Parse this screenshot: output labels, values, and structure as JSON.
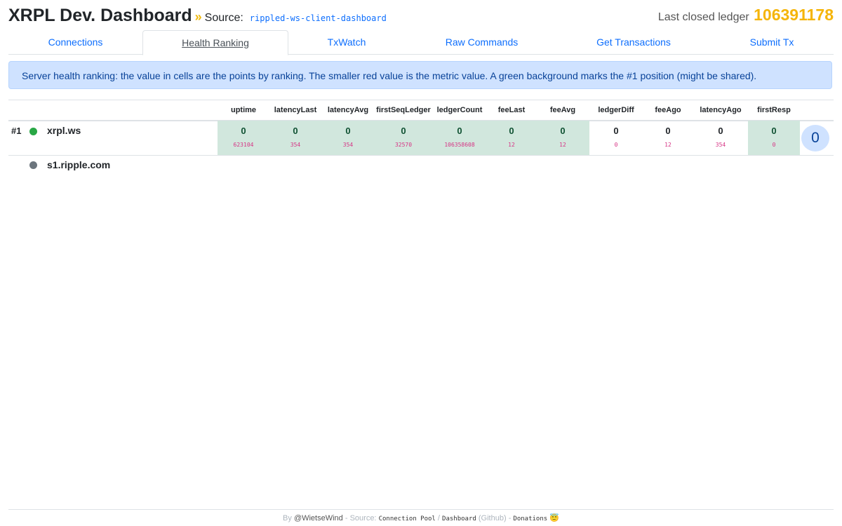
{
  "header": {
    "title": "XRPL Dev. Dashboard",
    "chevron": "»",
    "source_label": "Source:",
    "source_value": "rippled-ws-client-dashboard",
    "ledger_label": "Last closed ledger",
    "ledger_value": "106391178"
  },
  "tabs": [
    {
      "label": "Connections"
    },
    {
      "label": "Health Ranking"
    },
    {
      "label": "TxWatch"
    },
    {
      "label": "Raw Commands"
    },
    {
      "label": "Get Transactions"
    },
    {
      "label": "Submit Tx"
    }
  ],
  "info_alert": "Server health ranking: the value in cells are the points by ranking. The smaller red value is the metric value. A green background marks the #1 position (might be shared).",
  "columns": [
    "uptime",
    "latencyLast",
    "latencyAvg",
    "firstSeqLedger",
    "ledgerCount",
    "feeLast",
    "feeAvg",
    "ledgerDiff",
    "feeAgo",
    "latencyAgo",
    "firstResp"
  ],
  "servers": [
    {
      "rank": "#1",
      "name": "xrpl.ws",
      "status_color": "#28a745",
      "cells": [
        {
          "points": "0",
          "metric": "623104",
          "first": true
        },
        {
          "points": "0",
          "metric": "354",
          "first": true
        },
        {
          "points": "0",
          "metric": "354",
          "first": true
        },
        {
          "points": "0",
          "metric": "32570",
          "first": true
        },
        {
          "points": "0",
          "metric": "106358608",
          "first": true
        },
        {
          "points": "0",
          "metric": "12",
          "first": true
        },
        {
          "points": "0",
          "metric": "12",
          "first": true
        },
        {
          "points": "0",
          "metric": "0",
          "first": false
        },
        {
          "points": "0",
          "metric": "12",
          "first": false
        },
        {
          "points": "0",
          "metric": "354",
          "first": false
        },
        {
          "points": "0",
          "metric": "0",
          "first": true
        }
      ],
      "total": "0"
    },
    {
      "rank": "",
      "name": "s1.ripple.com",
      "status_color": "#6c757d"
    }
  ],
  "footer": {
    "by": "By",
    "author": "@WietseWind",
    "source_sep": "- Source:",
    "link1": "Connection Pool",
    "slash": "/",
    "link2": "Dashboard",
    "github": "(Github)",
    "dash": "-",
    "donations": "Donations",
    "emoji": "😇"
  }
}
